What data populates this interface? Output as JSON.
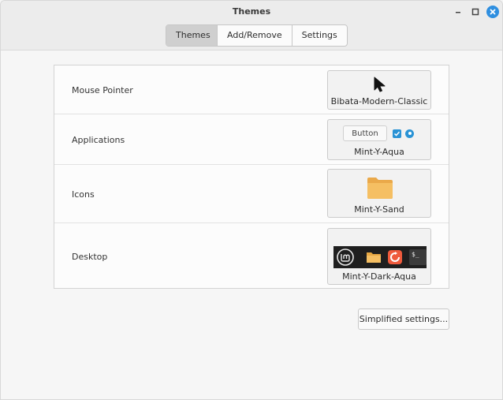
{
  "window": {
    "title": "Themes",
    "controls": [
      "minimize-icon",
      "maximize-icon",
      "close-icon"
    ],
    "accent_color": "#2f8fe0"
  },
  "tabs": [
    {
      "label": "Themes",
      "active": true
    },
    {
      "label": "Add/Remove",
      "active": false
    },
    {
      "label": "Settings",
      "active": false
    }
  ],
  "rows": {
    "mouse_pointer": {
      "label": "Mouse Pointer",
      "theme": "Bibata-Modern-Classic",
      "icon": "cursor-icon"
    },
    "applications": {
      "label": "Applications",
      "theme": "Mint-Y-Aqua",
      "preview_button": "Button"
    },
    "icons": {
      "label": "Icons",
      "theme": "Mint-Y-Sand",
      "icon": "folder-icon",
      "folder_color": "#f5bf63"
    },
    "desktop": {
      "label": "Desktop",
      "theme": "Mint-Y-Dark-Aqua",
      "preview_icons": [
        "mint-logo-icon",
        "folder-icon",
        "software-manager-icon",
        "terminal-icon"
      ],
      "terminal_text": "$_"
    }
  },
  "footer": {
    "simplified_label": "Simplified settings..."
  }
}
